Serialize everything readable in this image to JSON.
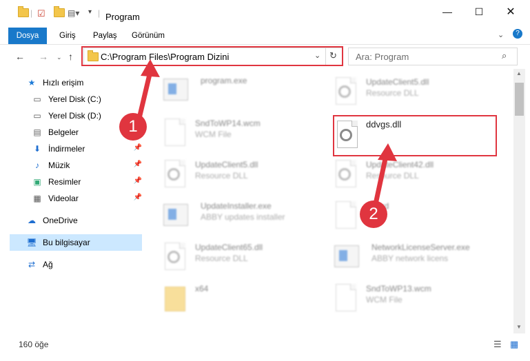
{
  "window": {
    "title": "Program"
  },
  "ribbon": {
    "tabs": [
      "Dosya",
      "Giriş",
      "Paylaş",
      "Görünüm"
    ]
  },
  "address": {
    "path": "C:\\Program Files\\Program Dizini"
  },
  "search": {
    "placeholder": "Ara: Program"
  },
  "sidebar": {
    "items": [
      {
        "label": "Hızlı erişim",
        "icon": "star-icon"
      },
      {
        "label": "Yerel Disk (C:)",
        "icon": "drive-icon"
      },
      {
        "label": "Yerel Disk (D:)",
        "icon": "drive-icon"
      },
      {
        "label": "Belgeler",
        "icon": "documents-icon"
      },
      {
        "label": "İndirmeler",
        "icon": "download-icon"
      },
      {
        "label": "Müzik",
        "icon": "music-icon"
      },
      {
        "label": "Resimler",
        "icon": "pictures-icon"
      },
      {
        "label": "Videolar",
        "icon": "videos-icon"
      },
      {
        "label": "OneDrive",
        "icon": "cloud-icon"
      },
      {
        "label": "Bu bilgisayar",
        "icon": "computer-icon"
      },
      {
        "label": "Ağ",
        "icon": "network-icon"
      }
    ]
  },
  "files": [
    {
      "name": "program.exe",
      "type": ""
    },
    {
      "name": "UpdateClient5.dll",
      "type": "Resource DLL"
    },
    {
      "name": "SndToWP14.wcm",
      "type": "WCM File"
    },
    {
      "name": "UpdateClient5.dll",
      "type": "Resource DLL"
    },
    {
      "name": "UpdateClient42.dll",
      "type": "Resource DLL"
    },
    {
      "name": "UpdateInstaller.exe",
      "type": "ABBY updates installer"
    },
    {
      "name": "...card",
      "type": ""
    },
    {
      "name": "UpdateClient65.dll",
      "type": "Resource DLL"
    },
    {
      "name": "NetworkLicenseServer.exe",
      "type": "ABBY network licens"
    },
    {
      "name": "x64",
      "type": ""
    },
    {
      "name": "SndToWP13.wcm",
      "type": "WCM File"
    }
  ],
  "selected_file": {
    "name": "ddvgs.dll"
  },
  "status": {
    "count": "160 öğe"
  },
  "annotations": {
    "step1": "1",
    "step2": "2",
    "color": "#e0353f"
  }
}
